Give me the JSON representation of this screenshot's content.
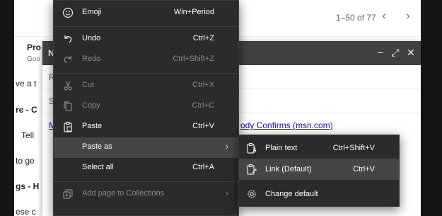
{
  "background": {
    "page_count": "1–50 of 77",
    "list_fragments": [
      "Pro",
      "Goo",
      "ve a t",
      "re - C",
      "Tell",
      "to ge",
      "gs - H",
      "ese c"
    ],
    "compose": {
      "title": "N",
      "field_letters": [
        "R",
        "S"
      ],
      "body_first_char": "M",
      "link_text": "ody Confirms (msn.com)"
    }
  },
  "context_menu": {
    "items": [
      {
        "label": "Emoji",
        "shortcut": "Win+Period",
        "icon": "emoji-icon",
        "disabled": false
      },
      {
        "label": "Undo",
        "shortcut": "Ctrl+Z",
        "icon": "undo-icon",
        "disabled": false
      },
      {
        "label": "Redo",
        "shortcut": "Ctrl+Shift+Z",
        "icon": "redo-icon",
        "disabled": true
      },
      {
        "label": "Cut",
        "shortcut": "Ctrl+X",
        "icon": "scissors-icon",
        "disabled": true
      },
      {
        "label": "Copy",
        "shortcut": "Ctrl+C",
        "icon": "copy-icon",
        "disabled": true
      },
      {
        "label": "Paste",
        "shortcut": "Ctrl+V",
        "icon": "clipboard-icon",
        "disabled": false
      },
      {
        "label": "Paste as",
        "shortcut": "",
        "icon": "",
        "disabled": false,
        "submenu": true,
        "highlighted": true
      },
      {
        "label": "Select all",
        "shortcut": "Ctrl+A",
        "icon": "",
        "disabled": false
      },
      {
        "label": "Add page to Collections",
        "shortcut": "",
        "icon": "collections-icon",
        "disabled": true,
        "submenu": true
      }
    ]
  },
  "submenu": {
    "items": [
      {
        "label": "Plain text",
        "shortcut": "Ctrl+Shift+V",
        "icon": "plain-text-paste-icon"
      },
      {
        "label": "Link (Default)",
        "shortcut": "Ctrl+V",
        "icon": "link-paste-icon",
        "highlighted": true
      },
      {
        "label": "Change default",
        "shortcut": "",
        "icon": "gear-icon"
      }
    ]
  },
  "colors": {
    "menu_bg": "#2b2b2b",
    "menu_highlight": "#454545",
    "compose_header": "#404040",
    "link_color": "#1a0dab"
  }
}
